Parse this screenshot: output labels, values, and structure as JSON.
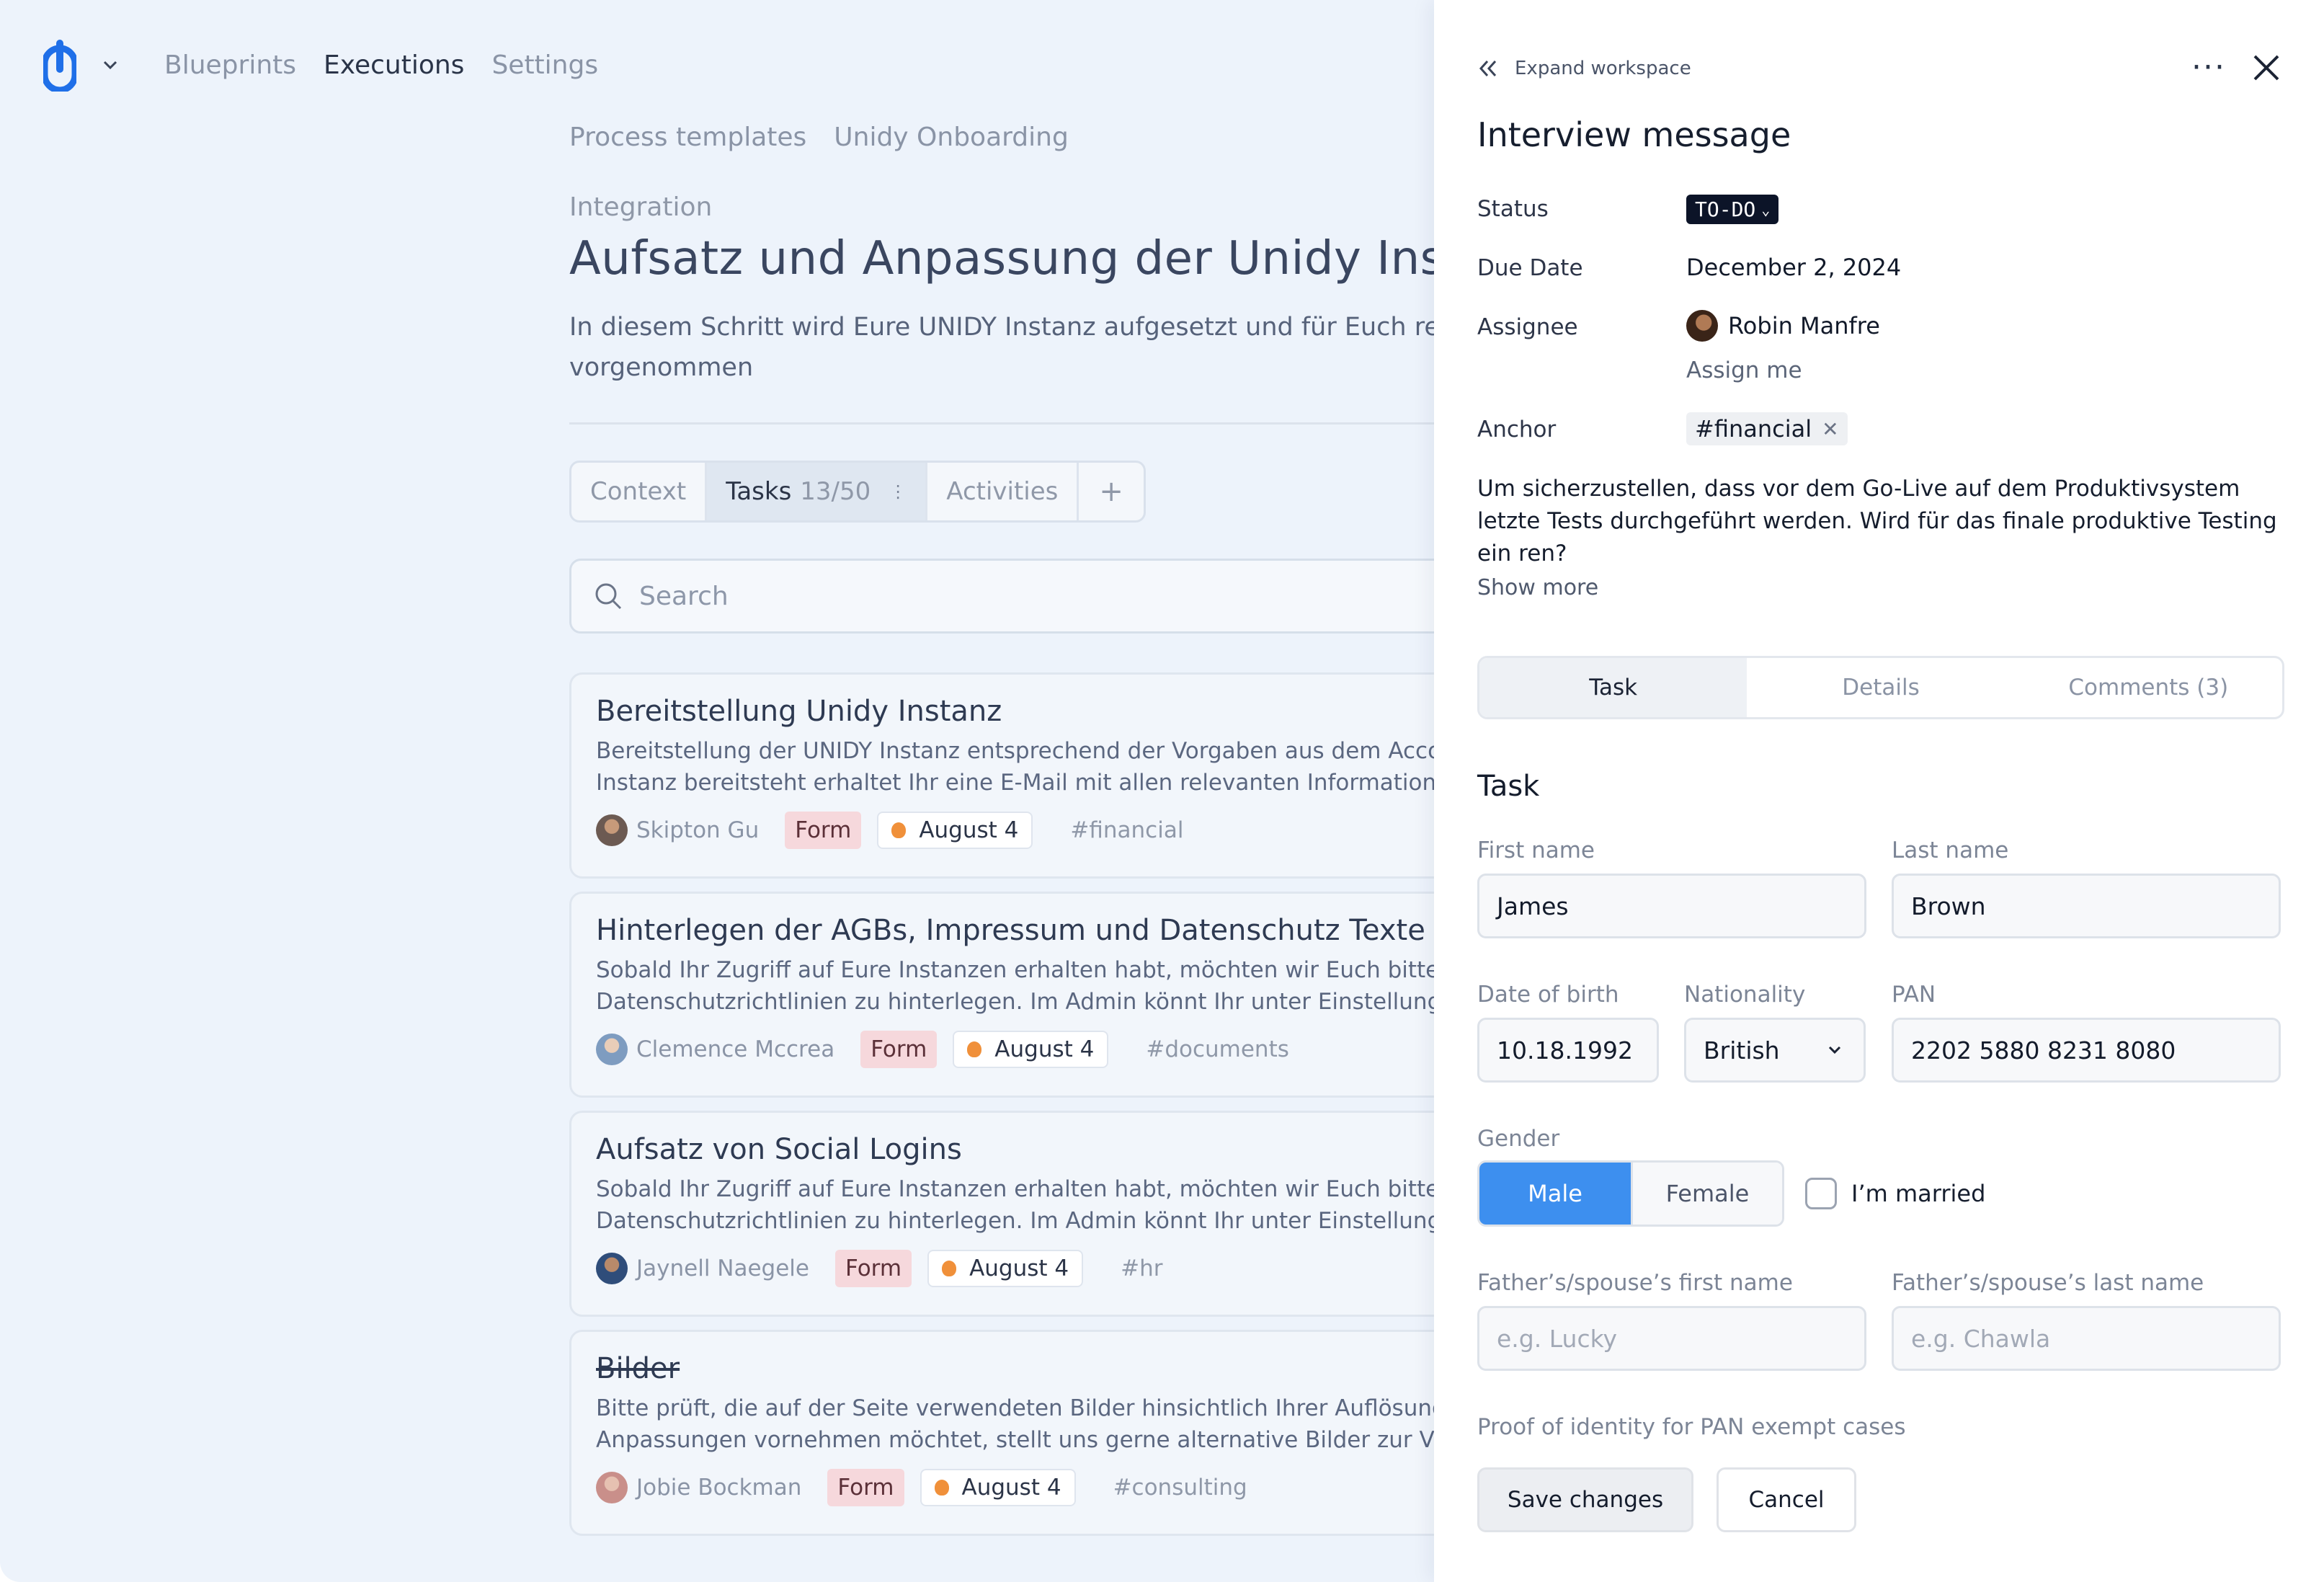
{
  "nav": {
    "items": [
      "Blueprints",
      "Executions",
      "Settings"
    ],
    "active_index": 1
  },
  "breadcrumb": [
    "Process templates",
    "Unidy Onboarding"
  ],
  "page": {
    "kicker": "Integration",
    "title": "Aufsatz und Anpassung der Unidy Insta",
    "description_line1": "In diesem Schritt wird Eure UNIDY Instanz aufgesetzt und für Euch rele",
    "description_line2": "vorgenommen"
  },
  "tabs": {
    "context": "Context",
    "tasks": "Tasks",
    "tasks_count": "13/50",
    "activities": "Activities",
    "add": "+"
  },
  "search": {
    "placeholder": "Search"
  },
  "cards": [
    {
      "title": "Bereitstellung Unidy Instanz",
      "line1": "Bereitstellung der UNIDY Instanz entsprechend der Vorgaben aus dem Accoun",
      "line2": "Instanz bereitsteht erhaltet Ihr eine E-Mail mit allen relevanten Informationen z",
      "assignee": "Skipton Gu",
      "form": "Form",
      "date": "August 4",
      "tag": "#financial",
      "strike": false
    },
    {
      "title": "Hinterlegen der AGBs, Impressum und Datenschutz Texte",
      "line1": "Sobald Ihr Zugriff auf Eure Instanzen erhalten habt, möchten wir Euch bitten, E",
      "line2": "Datenschutzrichtlinien zu hinterlegen. Im Admin könnt Ihr unter Einstellungen -",
      "assignee": "Clemence Mccrea",
      "form": "Form",
      "date": "August 4",
      "tag": "#documents",
      "strike": false
    },
    {
      "title": "Aufsatz von Social Logins",
      "line1": "Sobald Ihr Zugriff auf Eure Instanzen erhalten habt, möchten wir Euch bitten, E",
      "line2": "Datenschutzrichtlinien zu hinterlegen. Im Admin könnt Ihr unter Einstellungen -",
      "assignee": "Jaynell Naegele",
      "form": "Form",
      "date": "August 4",
      "tag": "#hr",
      "strike": false
    },
    {
      "title": "Bilder",
      "line1": "Bitte prüft, die auf der Seite verwendeten Bilder hinsichtlich Ihrer Auflösung un",
      "line2": "Anpassungen vornehmen möchtet, stellt uns gerne alternative Bilder zur Verfü",
      "assignee": "Jobie Bockman",
      "form": "Form",
      "date": "August 4",
      "tag": "#consulting",
      "strike": true
    }
  ],
  "panel": {
    "expand_label": "Expand workspace",
    "more_label": "···",
    "title": "Interview message",
    "status_label": "Status",
    "status_value": "TO-DO",
    "due_label": "Due Date",
    "due_value": "December 2, 2024",
    "assignee_label": "Assignee",
    "assignee_value": "Robin Manfre",
    "assign_me": "Assign me",
    "anchor_label": "Anchor",
    "anchor_value": "#financial",
    "description": "Um sicherzustellen, dass vor dem Go-Live auf dem Produktivsystem letzte Tests durchgeführt werden. Wird für das finale produktive Testing ein ren?",
    "show_more": "Show more",
    "tabs": [
      "Task",
      "Details",
      "Comments (3)"
    ],
    "active_tab": 0,
    "section_title": "Task",
    "form": {
      "first_name_label": "First name",
      "first_name_value": "James",
      "last_name_label": "Last name",
      "last_name_value": "Brown",
      "dob_label": "Date of birth",
      "dob_value": "10.18.1992",
      "nationality_label": "Nationality",
      "nationality_value": "British",
      "pan_label": "PAN",
      "pan_value": "2202 5880 8231 8080",
      "gender_label": "Gender",
      "gender_male": "Male",
      "gender_female": "Female",
      "gender_selected": "Male",
      "married_label": "I’m married",
      "married_checked": false,
      "father_first_label": "Father’s/spouse’s first name",
      "father_first_placeholder": "e.g. Lucky",
      "father_last_label": "Father’s/spouse’s last name",
      "father_last_placeholder": "e.g. Chawla",
      "proof_label": "Proof of identity for PAN exempt cases"
    },
    "save_label": "Save changes",
    "cancel_label": "Cancel"
  },
  "colors": {
    "accent": "#3d8fef",
    "brand_logo": "#1f6fe8",
    "workspace_bg": "#edf3fb",
    "status_pill": "#0c1428",
    "form_chip": "#f6d8dc",
    "date_dot": "#f0903a"
  }
}
